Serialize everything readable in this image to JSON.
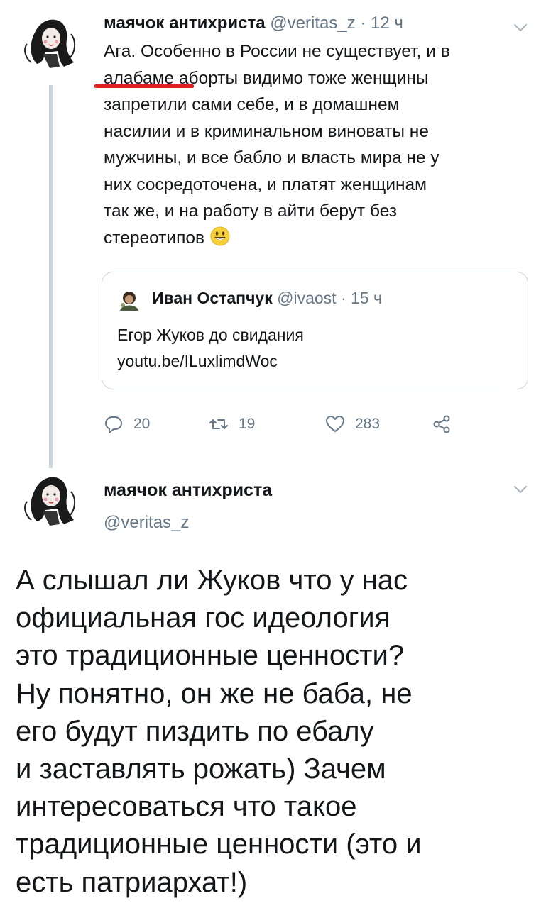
{
  "tweet1": {
    "author_name": "маячок антихриста",
    "handle": "@veritas_z",
    "separator": "·",
    "time": "12 ч",
    "text_lines": [
      "Ага. Особенно в России не существует, и в",
      "алабаме аборты видимо тоже женщины",
      "запретили сами себе, и в домашнем",
      "насилии и в криминальном виноваты не",
      "мужчины, и все бабло и власть мира не у",
      "них сосредоточена, и платят женщинам",
      "так же, и на работу в айти берут без",
      "стереотипов"
    ],
    "emoji_icon": "smiling-face-emoji",
    "highlight_color": "#e0201b",
    "quoted": {
      "author_name": "Иван Остапчук",
      "handle": "@ivaost",
      "separator": "·",
      "time": "15 ч",
      "text_lines": [
        "Егор Жуков до свидания",
        "youtu.be/ILuxlimdWoc"
      ]
    },
    "actions": {
      "reply_count": "20",
      "retweet_count": "19",
      "like_count": "283"
    }
  },
  "tweet2": {
    "author_name": "маячок антихриста",
    "handle": "@veritas_z",
    "text_lines": [
      "А слышал ли Жуков что у нас",
      "официальная гос идеология",
      "это традиционные ценности?",
      "Ну понятно, он же не баба, не",
      "его будут пиздить по ебалу",
      "и заставлять рожать) Зачем",
      "интересоваться что такое",
      "традиционные ценности (это и",
      "есть патриархат!)"
    ]
  },
  "colors": {
    "text": "#14171a",
    "secondary": "#657786",
    "border": "#ccd6dd"
  }
}
